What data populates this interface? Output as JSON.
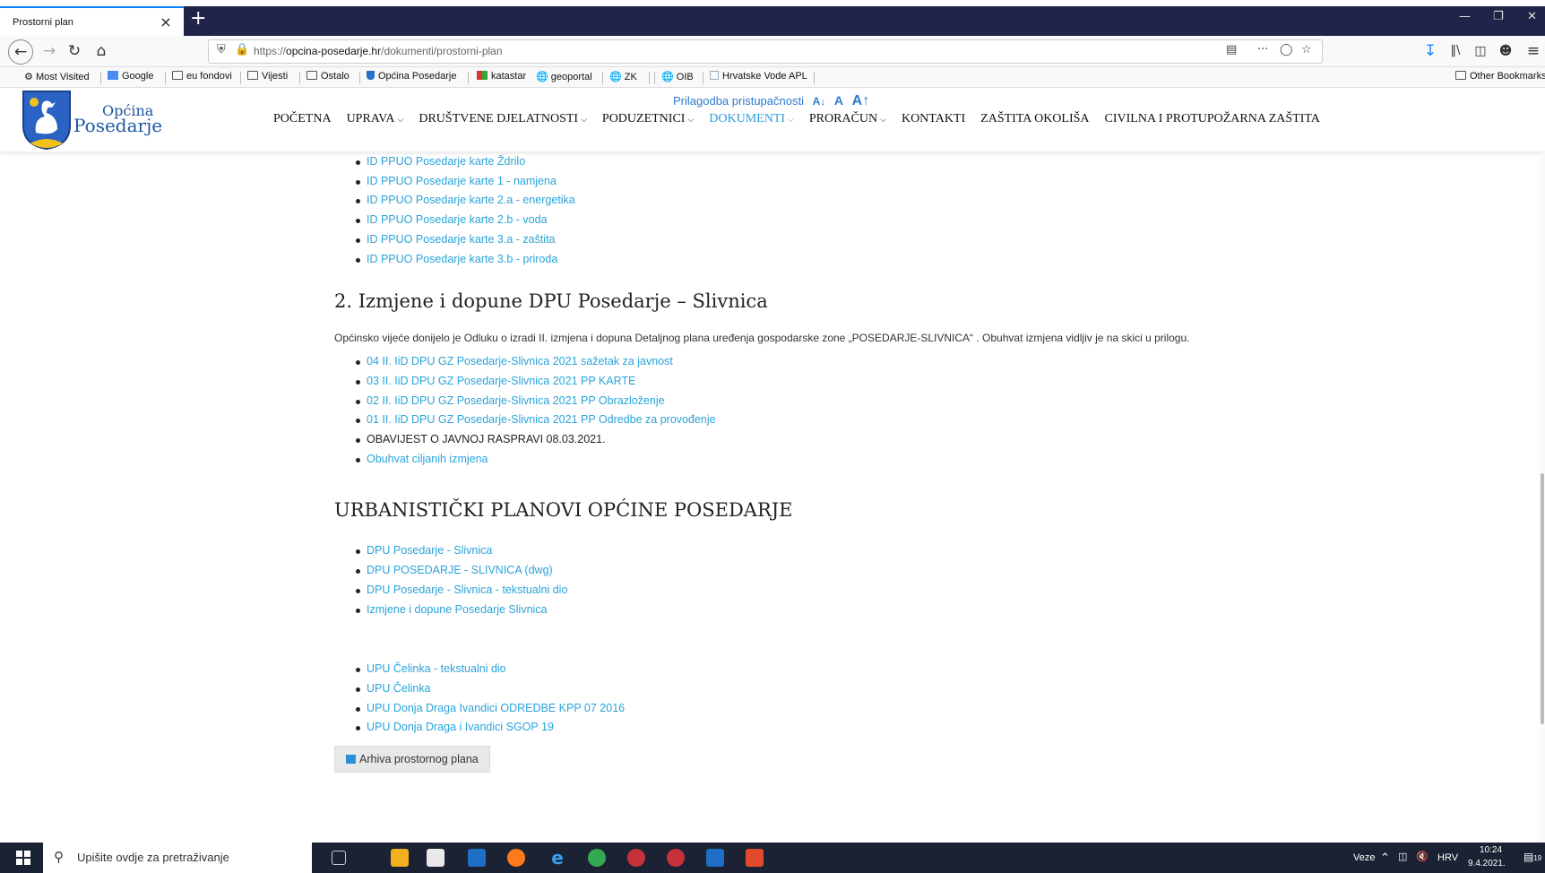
{
  "browser": {
    "tab_title": "Prostorni plan",
    "tab_close": "×",
    "new_tab": "+",
    "url_prefix": "https://",
    "url_host": "opcina-posedarje.hr",
    "url_path": "/dokumenti/prostorni-plan",
    "page_actions": "···"
  },
  "bookmarks": [
    {
      "label": "Most Visited",
      "icon": "gear-icon"
    },
    {
      "label": "Google",
      "icon": "google-icon"
    },
    {
      "label": "eu fondovi",
      "icon": "folder-icon"
    },
    {
      "label": "Vijesti",
      "icon": "folder-icon"
    },
    {
      "label": "Ostalo",
      "icon": "folder-icon"
    },
    {
      "label": "Općina Posedarje",
      "icon": "crest-icon"
    },
    {
      "label": "katastar",
      "icon": "katastar-icon"
    },
    {
      "label": "geoportal",
      "icon": "globe-icon"
    },
    {
      "label": "ZK",
      "icon": "globe-icon"
    },
    {
      "label": "OIB",
      "icon": "globe-icon"
    },
    {
      "label": "Hrvatske Vode APL",
      "icon": "page-icon"
    }
  ],
  "other_bookmarks": "Other Bookmarks",
  "site": {
    "logo_line1": "Općina",
    "logo_line2": "Posedarje",
    "accessibility_label": "Prilagodba pristupačnosti",
    "access_small": "A↓",
    "access_normal": "A",
    "access_large": "A↑",
    "menu": [
      {
        "label": "POČETNA",
        "dropdown": false,
        "active": false
      },
      {
        "label": "UPRAVA",
        "dropdown": true,
        "active": false
      },
      {
        "label": "DRUŠTVENE DJELATNOSTI",
        "dropdown": true,
        "active": false
      },
      {
        "label": "PODUZETNICI",
        "dropdown": true,
        "active": false
      },
      {
        "label": "DOKUMENTI",
        "dropdown": true,
        "active": true
      },
      {
        "label": "PRORAČUN",
        "dropdown": true,
        "active": false
      },
      {
        "label": "KONTAKTI",
        "dropdown": false,
        "active": false
      },
      {
        "label": "ZAŠTITA OKOLIŠA",
        "dropdown": false,
        "active": false
      },
      {
        "label": "CIVILNA I PROTUPOŽARNA ZAŠTITA",
        "dropdown": false,
        "active": false
      }
    ]
  },
  "content": {
    "top_links": [
      "ID PPUO Posedarje karte Ždrilo",
      "ID PPUO Posedarje karte 1 - namjena",
      "ID PPUO Posedarje karte 2.a - energetika",
      "ID PPUO Posedarje karte 2.b - voda",
      "ID PPUO Posedarje karte 3.a - zaštita",
      "ID PPUO Posedarje karte 3.b - priroda"
    ],
    "section2_title": "2. Izmjene i dopune DPU Posedarje – Slivnica",
    "section2_paragraph": "Općinsko vijeće donijelo je Odluku o izradi II. izmjena i dopuna Detaljnog plana uređenja gospodarske zone „POSEDARJE-SLIVNICA“ . Obuhvat izmjena vidljiv je na skici u prilogu.",
    "section2_links": [
      {
        "text": "04 II. IiD DPU GZ Posedarje-Slivnica 2021 sažetak za javnost",
        "link": true
      },
      {
        "text": "03 II. IiD DPU GZ Posedarje-Slivnica 2021 PP KARTE",
        "link": true
      },
      {
        "text": "02 II. IiD DPU GZ Posedarje-Slivnica 2021 PP Obrazloženje",
        "link": true
      },
      {
        "text": "01 II. IiD DPU GZ Posedarje-Slivnica 2021 PP Odredbe za provođenje",
        "link": true
      },
      {
        "text": "OBAVIJEST O JAVNOJ RASPRAVI 08.03.2021.",
        "link": false
      },
      {
        "text": "Obuhvat ciljanih izmjena",
        "link": true
      }
    ],
    "section3_title": "URBANISTIČKI PLANOVI OPĆINE POSEDARJE",
    "section3_links_a": [
      "DPU Posedarje - Slivnica",
      "DPU POSEDARJE - SLIVNICA (dwg)",
      "DPU Posedarje - Slivnica - tekstualni dio",
      "Izmjene i dopune Posedarje Slivnica"
    ],
    "section3_links_b": [
      "UPU Čelinka - tekstualni dio",
      "UPU Čelinka",
      "UPU Donja Draga Ivandici ODREDBE KPP 07 2016",
      "UPU Donja Draga i Ivandici SGOP 19"
    ],
    "archive_button": "Arhiva prostornog plana"
  },
  "taskbar": {
    "search_placeholder": "Upišite ovdje za pretraživanje",
    "network_label": "Veze",
    "language": "HRV",
    "time": "10:24",
    "date": "9.4.2021.",
    "notif_count": "19"
  },
  "colors": {
    "link": "#2aa3d9",
    "brand": "#1c57a5",
    "tab_strip": "#1f2448",
    "taskbar": "#1b2233"
  }
}
